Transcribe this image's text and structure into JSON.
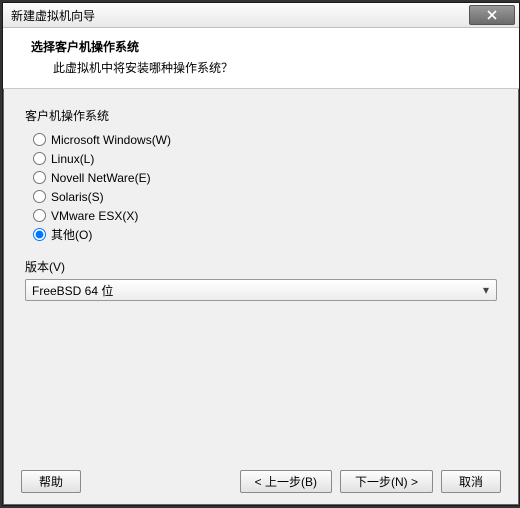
{
  "window": {
    "title": "新建虚拟机向导"
  },
  "header": {
    "title": "选择客户机操作系统",
    "subtitle": "此虚拟机中将安装哪种操作系统？"
  },
  "guest_os": {
    "section_label": "客户机操作系统",
    "options": [
      {
        "label": "Microsoft Windows(W)",
        "selected": false
      },
      {
        "label": "Linux(L)",
        "selected": false
      },
      {
        "label": "Novell NetWare(E)",
        "selected": false
      },
      {
        "label": "Solaris(S)",
        "selected": false
      },
      {
        "label": "VMware ESX(X)",
        "selected": false
      },
      {
        "label": "其他(O)",
        "selected": true
      }
    ]
  },
  "version": {
    "label": "版本(V)",
    "selected": "FreeBSD 64 位"
  },
  "footer": {
    "help": "帮助",
    "back": "< 上一步(B)",
    "next": "下一步(N) >",
    "cancel": "取消"
  }
}
